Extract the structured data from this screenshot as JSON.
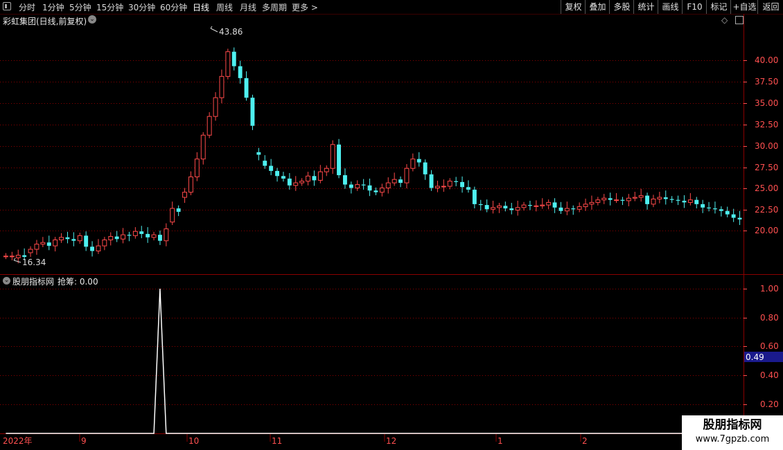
{
  "toolbar": {
    "left_items": [
      "分时",
      "1分钟",
      "5分钟",
      "15分钟",
      "30分钟",
      "60分钟",
      "日线",
      "周线",
      "月线",
      "多周期",
      "更多 >"
    ],
    "active": "日线",
    "right_items": [
      "复权",
      "叠加",
      "多股",
      "统计",
      "画线",
      "F10",
      "标记",
      "+自选",
      "返回"
    ]
  },
  "main_panel": {
    "title": "彩虹集团(日线,前复权)",
    "high_label": "43.86",
    "low_label": "16.34",
    "y_ticks": [
      "40.00",
      "37.50",
      "35.00",
      "32.50",
      "30.00",
      "27.50",
      "25.00",
      "22.50",
      "20.00"
    ]
  },
  "indicator_panel": {
    "name": "股朋指标网",
    "readout_label": "抢筹: 0.00",
    "y_ticks": [
      "1.00",
      "0.80",
      "0.60",
      "0.40",
      "0.20"
    ],
    "current_value": "0.49"
  },
  "x_axis": {
    "labels": [
      "2022年",
      "9",
      "10",
      "11",
      "12",
      "1",
      "2"
    ]
  },
  "watermark": {
    "line1": "股朋指标网",
    "line2": "www.7gpzb.com"
  },
  "colors": {
    "up": "#ff4a4a",
    "down": "#4ef0f0",
    "grid": "#8b0000",
    "axis_text": "#ff5050",
    "highlight_box": "#1a1a8c"
  },
  "chart_data": {
    "type": "candlestick",
    "series_close": [
      17.0,
      17.0,
      17.1,
      16.9,
      17.8,
      18.4,
      18.6,
      18.2,
      18.9,
      19.2,
      19.0,
      18.8,
      19.4,
      18.1,
      17.6,
      18.2,
      18.9,
      19.3,
      19.0,
      19.5,
      19.4,
      19.9,
      19.6,
      19.2,
      19.5,
      18.8,
      20.2,
      22.6,
      22.2,
      24.5,
      26.3,
      28.4,
      31.2,
      33.4,
      35.6,
      38.1,
      41.0,
      39.3,
      37.9,
      35.6,
      32.3,
      28.9,
      27.6,
      27.0,
      26.4,
      26.1,
      25.3,
      25.6,
      25.8,
      26.4,
      25.9,
      26.9,
      27.3,
      30.1,
      26.5,
      25.4,
      25.0,
      25.4,
      25.3,
      24.7,
      24.5,
      25.0,
      25.6,
      26.0,
      25.6,
      27.3,
      28.4,
      28.0,
      26.6,
      25.0,
      25.2,
      25.2,
      25.8,
      25.7,
      25.1,
      24.8,
      23.1,
      23.0,
      22.5,
      22.7,
      22.9,
      22.6,
      22.4,
      22.7,
      23.0,
      22.9,
      22.9,
      23.0,
      23.3,
      22.7,
      22.3,
      22.6,
      22.5,
      22.8,
      23.1,
      23.3,
      23.6,
      23.8,
      23.6,
      23.6,
      23.5,
      23.8,
      23.9,
      24.1,
      23.1,
      23.7,
      23.9,
      23.7,
      23.6,
      23.5,
      23.3,
      23.6,
      23.1,
      22.7,
      22.6,
      22.5,
      22.3,
      21.9,
      21.5,
      21.3
    ],
    "series_open": [
      17.0,
      17.0,
      16.8,
      17.1,
      17.4,
      17.8,
      18.4,
      18.6,
      18.2,
      18.9,
      19.2,
      19.0,
      18.8,
      19.4,
      18.1,
      17.6,
      18.2,
      18.9,
      19.3,
      19.0,
      19.5,
      19.4,
      19.9,
      19.6,
      19.2,
      19.5,
      18.8,
      21.0,
      22.6,
      23.9,
      24.5,
      26.3,
      28.4,
      31.2,
      33.4,
      35.6,
      38.1,
      41.0,
      39.3,
      37.9,
      35.6,
      29.2,
      28.2,
      27.6,
      27.0,
      26.4,
      26.1,
      25.3,
      25.6,
      25.8,
      26.4,
      25.9,
      26.9,
      27.3,
      30.1,
      26.5,
      25.4,
      25.0,
      25.4,
      25.3,
      24.7,
      24.5,
      25.0,
      25.6,
      26.0,
      25.6,
      27.3,
      28.4,
      28.0,
      26.6,
      25.0,
      25.2,
      25.2,
      25.8,
      25.7,
      25.1,
      24.8,
      23.1,
      23.0,
      22.5,
      22.7,
      22.9,
      22.6,
      22.4,
      22.7,
      23.0,
      22.9,
      22.9,
      23.0,
      23.3,
      22.7,
      22.3,
      22.6,
      22.5,
      22.8,
      23.1,
      23.3,
      23.6,
      23.8,
      23.6,
      23.6,
      23.5,
      23.8,
      23.9,
      24.1,
      23.1,
      23.7,
      23.9,
      23.7,
      23.6,
      23.5,
      23.3,
      23.6,
      23.1,
      22.7,
      22.6,
      22.5,
      22.3,
      21.9,
      21.5
    ],
    "price_ylim": [
      16.34,
      43.86
    ],
    "indicator_values": [
      0,
      0,
      0,
      0,
      0,
      0,
      0,
      0,
      0,
      0,
      0,
      0,
      0,
      0,
      0,
      0,
      0,
      0,
      0,
      0,
      0,
      0,
      0,
      0,
      0,
      1,
      0,
      0,
      0,
      0,
      0,
      0,
      0,
      0,
      0,
      0,
      0,
      0,
      0,
      0,
      0,
      0,
      0,
      0,
      0,
      0,
      0,
      0,
      0,
      0,
      0,
      0,
      0,
      0,
      0,
      0,
      0,
      0,
      0,
      0,
      0,
      0,
      0,
      0,
      0,
      0,
      0,
      0,
      0,
      0,
      0,
      0,
      0,
      0,
      0,
      0,
      0,
      0,
      0,
      0,
      0,
      0,
      0,
      0,
      0,
      0,
      0,
      0,
      0,
      0,
      0,
      0,
      0,
      0,
      0,
      0,
      0,
      0,
      0,
      0,
      0,
      0,
      0,
      0,
      0,
      0,
      0,
      0,
      0,
      0,
      0,
      0,
      0,
      0,
      0,
      0,
      0,
      0,
      0,
      0
    ],
    "indicator_ylim": [
      0,
      1
    ]
  }
}
